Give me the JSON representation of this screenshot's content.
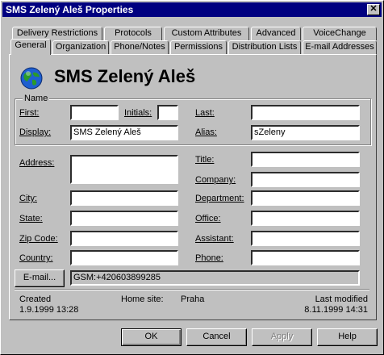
{
  "window": {
    "title": "SMS Zelený Aleš Properties",
    "close_glyph": "✕"
  },
  "tabs_row1": [
    "Delivery Restrictions",
    "Protocols",
    "Custom Attributes",
    "Advanced",
    "VoiceChange"
  ],
  "tabs_row2": [
    "General",
    "Organization",
    "Phone/Notes",
    "Permissions",
    "Distribution Lists",
    "E-mail Addresses"
  ],
  "active_tab": "General",
  "header": {
    "display_name": "SMS Zelený Aleš",
    "icon": "globe-icon"
  },
  "name_group": {
    "label": "Name",
    "first_label": "First:",
    "first_value": "",
    "initials_label": "Initials:",
    "initials_value": "",
    "last_label": "Last:",
    "last_value": "",
    "display_label": "Display:",
    "display_value": "SMS Zelený Aleš",
    "alias_label": "Alias:",
    "alias_value": "sZeleny"
  },
  "address": {
    "address_label": "Address:",
    "address_value": "",
    "city_label": "City:",
    "city_value": "",
    "state_label": "State:",
    "state_value": "",
    "zip_label": "Zip Code:",
    "zip_value": "",
    "country_label": "Country:",
    "country_value": ""
  },
  "org": {
    "title_label": "Title:",
    "title_value": "",
    "company_label": "Company:",
    "company_value": "",
    "department_label": "Department:",
    "department_value": "",
    "office_label": "Office:",
    "office_value": "",
    "assistant_label": "Assistant:",
    "assistant_value": "",
    "phone_label": "Phone:",
    "phone_value": ""
  },
  "email": {
    "button_label": "E-mail...",
    "value": "GSM:+420603899285"
  },
  "info": {
    "created_label": "Created",
    "created_value": "1.9.1999  13:28",
    "home_site_label": "Home site:",
    "home_site_value": "Praha",
    "modified_label": "Last modified",
    "modified_value": "8.11.1999  14:31"
  },
  "buttons": {
    "ok": "OK",
    "cancel": "Cancel",
    "apply": "Apply",
    "help": "Help"
  }
}
